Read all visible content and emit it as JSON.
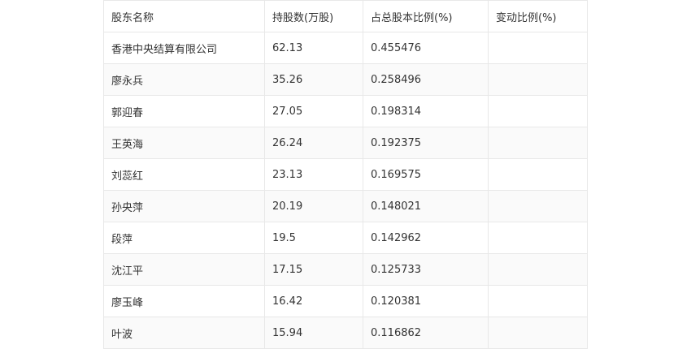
{
  "table": {
    "headers": [
      "股东名称",
      "持股数(万股)",
      "占总股本比例(%)",
      "变动比例(%)"
    ],
    "rows": [
      [
        "香港中央结算有限公司",
        "62.13",
        "0.455476",
        ""
      ],
      [
        "廖永兵",
        "35.26",
        "0.258496",
        ""
      ],
      [
        "郭迎春",
        "27.05",
        "0.198314",
        ""
      ],
      [
        "王英海",
        "26.24",
        "0.192375",
        ""
      ],
      [
        "刘蕊红",
        "23.13",
        "0.169575",
        ""
      ],
      [
        "孙央萍",
        "20.19",
        "0.148021",
        ""
      ],
      [
        "段萍",
        "19.5",
        "0.142962",
        ""
      ],
      [
        "沈江平",
        "17.15",
        "0.125733",
        ""
      ],
      [
        "廖玉峰",
        "16.42",
        "0.120381",
        ""
      ],
      [
        "叶波",
        "15.94",
        "0.116862",
        ""
      ]
    ]
  }
}
